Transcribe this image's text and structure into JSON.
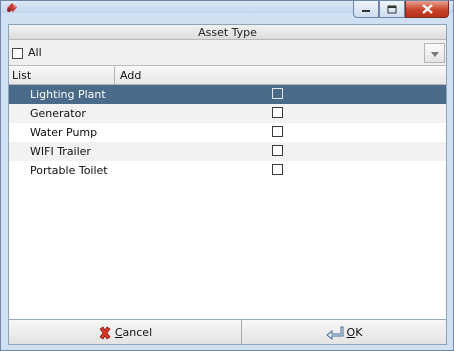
{
  "window": {
    "app_icon": "app-icon",
    "min_icon": "minimize-icon",
    "max_icon": "maximize-icon",
    "close_icon": "close-icon"
  },
  "header": {
    "title": "Asset Type"
  },
  "filter": {
    "label": "All",
    "dropdown_icon": "chevron-down-icon"
  },
  "columns": {
    "list": "List",
    "add": "Add"
  },
  "rows": [
    {
      "label": "Lighting Plant",
      "selected": true
    },
    {
      "label": "Generator"
    },
    {
      "label": "Water Pump"
    },
    {
      "label": "WIFI Trailer"
    },
    {
      "label": "Portable Toilet"
    }
  ],
  "buttons": {
    "cancel_mnemonic": "C",
    "cancel_rest": "ancel",
    "cancel_icon": "cancel-x-icon",
    "ok_mnemonic": "O",
    "ok_rest": "K",
    "ok_icon": "return-arrow-icon"
  },
  "colors": {
    "selected_row": "#4a6a89",
    "frame": "#cfe0f2"
  }
}
